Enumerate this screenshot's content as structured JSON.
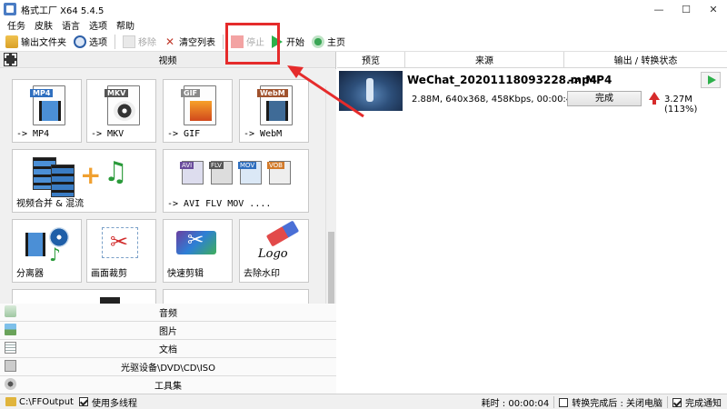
{
  "window": {
    "title": "格式工厂 X64 5.4.5",
    "controls": [
      "—",
      "☐",
      "✕"
    ]
  },
  "menu": [
    "任务",
    "皮肤",
    "语言",
    "选项",
    "帮助"
  ],
  "toolbar": {
    "output_folder": "输出文件夹",
    "options": "选项",
    "remove": "移除",
    "clear_list": "清空列表",
    "stop": "停止",
    "start": "开始",
    "home": "主页"
  },
  "left": {
    "video_header": "视频",
    "tiles": [
      {
        "tag": "MP4",
        "label": "-> MP4"
      },
      {
        "tag": "MKV",
        "label": "-> MKV"
      },
      {
        "tag": "GIF",
        "label": "-> GIF"
      },
      {
        "tag": "WebM",
        "label": "-> WebM"
      },
      {
        "label": "视频合并 & 混流"
      },
      {
        "tags": [
          "AVI",
          "FLV",
          "MOV",
          "VOB"
        ],
        "label": "-> AVI FLV MOV ...."
      },
      {
        "label": "分离器"
      },
      {
        "label": "画面裁剪"
      },
      {
        "label": "快速剪辑"
      },
      {
        "label": "去除水印",
        "logo_text": "Logo"
      }
    ],
    "categories": [
      "音频",
      "图片",
      "文档",
      "光驱设备\\DVD\\CD\\ISO",
      "工具集"
    ]
  },
  "right": {
    "columns": [
      "预览",
      "来源",
      "输出 / 转换状态"
    ],
    "task": {
      "filename": "WeChat_20201118093228.mp4",
      "target": "-> MP4",
      "info": "2.88M, 640x368, 458Kbps, 00:00:46",
      "status": "完成",
      "output": "3.27M  (113%)"
    }
  },
  "status": {
    "path": "C:\\FFOutput",
    "multithread": "使用多线程",
    "elapsed": "耗时 : 00:00:04",
    "after_convert": "转换完成后 : 关闭电脑",
    "notify": "完成通知"
  }
}
